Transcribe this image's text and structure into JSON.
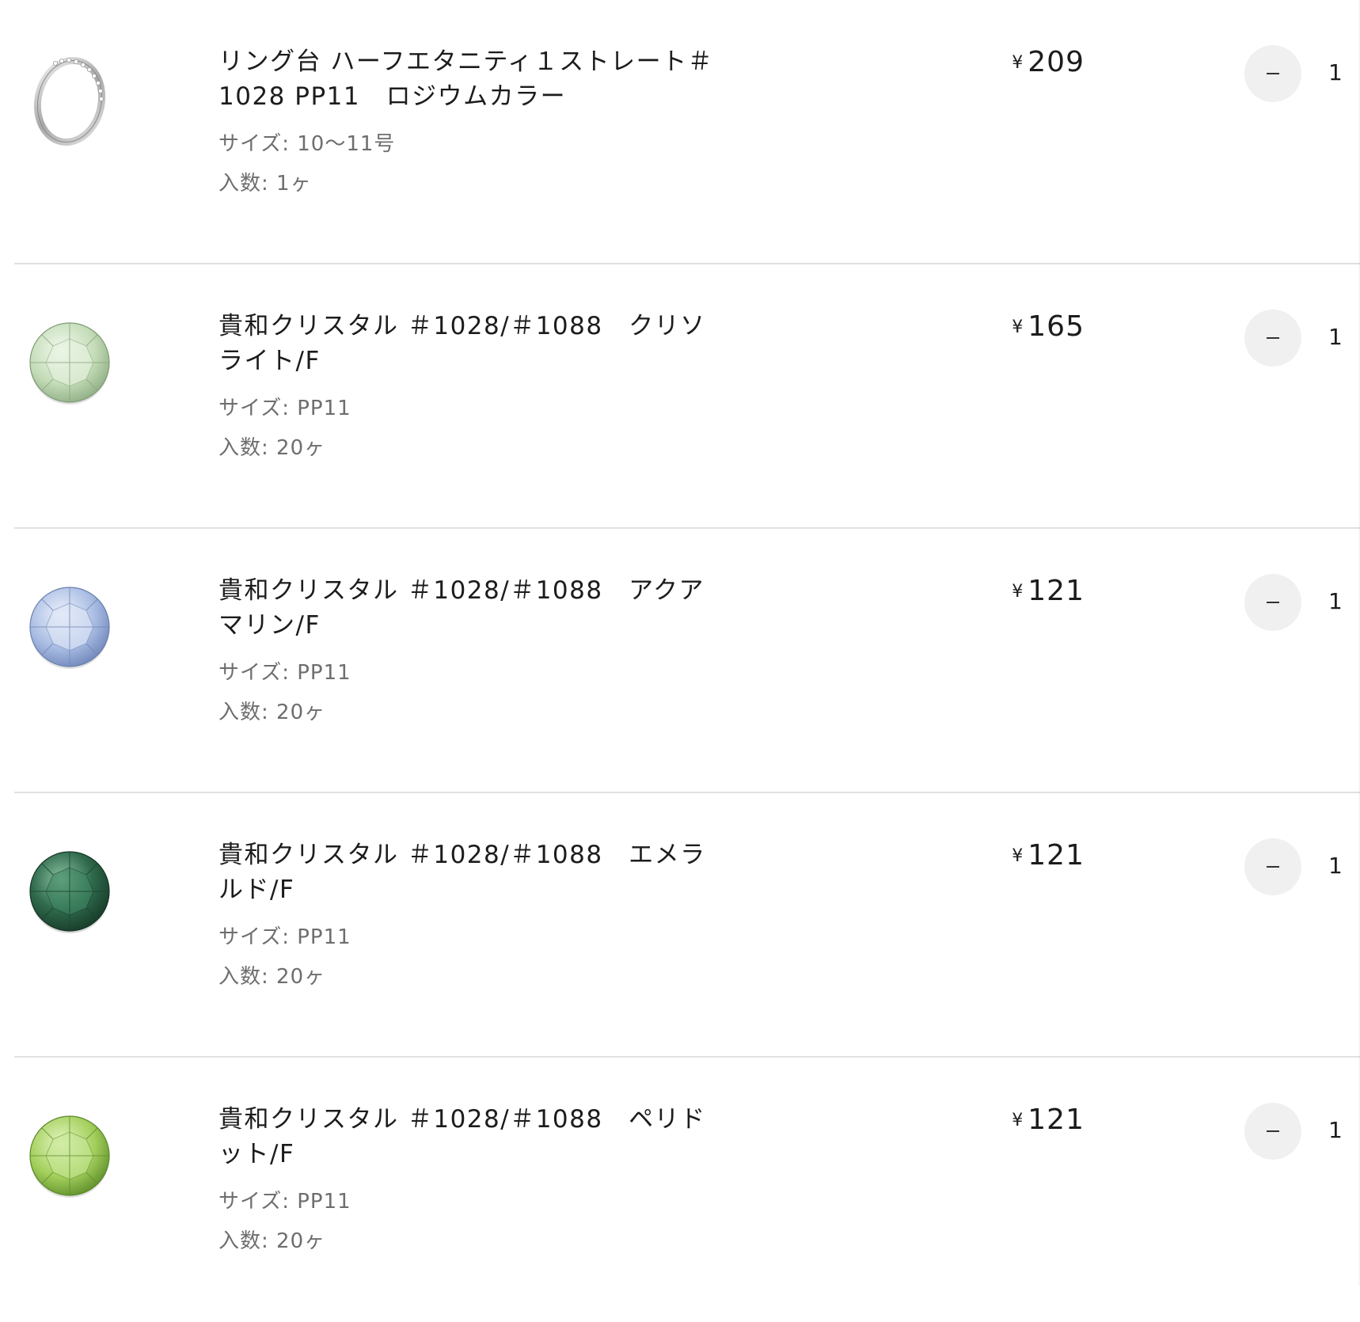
{
  "cart": {
    "currency_symbol": "¥",
    "items": [
      {
        "title_line1": "リング台 ハーフエタニティ１ストレート＃",
        "title_line2": "1028 PP11　ロジウムカラー",
        "size": "サイズ: 10〜11号",
        "quantity_per_pack": "入数: 1ヶ",
        "price": "209",
        "quantity": "1",
        "minus_label": "–",
        "thumbnail_icon": "silver-ring",
        "color": "#c9c9c9"
      },
      {
        "title_line1": "貴和クリスタル ＃1028/＃1088　クリソ",
        "title_line2": "ライト/F",
        "size": "サイズ: PP11",
        "quantity_per_pack": "入数: 20ヶ",
        "price": "165",
        "quantity": "1",
        "minus_label": "–",
        "thumbnail_icon": "crystal-chrysolite",
        "color": "#c4dcb8"
      },
      {
        "title_line1": "貴和クリスタル ＃1028/＃1088　アクア",
        "title_line2": "マリン/F",
        "size": "サイズ: PP11",
        "quantity_per_pack": "入数: 20ヶ",
        "price": "121",
        "quantity": "1",
        "minus_label": "–",
        "thumbnail_icon": "crystal-aquamarine",
        "color": "#a9bde3"
      },
      {
        "title_line1": "貴和クリスタル ＃1028/＃1088　エメラ",
        "title_line2": "ルド/F",
        "size": "サイズ: PP11",
        "quantity_per_pack": "入数: 20ヶ",
        "price": "121",
        "quantity": "1",
        "minus_label": "–",
        "thumbnail_icon": "crystal-emerald",
        "color": "#2f6a4c"
      },
      {
        "title_line1": "貴和クリスタル ＃1028/＃1088　ペリド",
        "title_line2": "ット/F",
        "size": "サイズ: PP11",
        "quantity_per_pack": "入数: 20ヶ",
        "price": "121",
        "quantity": "1",
        "minus_label": "–",
        "thumbnail_icon": "crystal-peridot",
        "color": "#a3cf5c"
      }
    ]
  }
}
